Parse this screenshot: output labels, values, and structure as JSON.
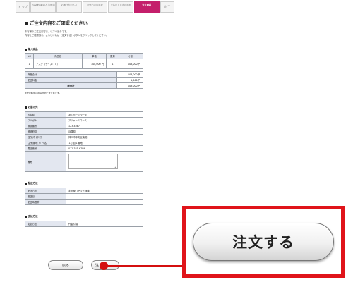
{
  "steps": [
    {
      "label": "ト ップ"
    },
    {
      "label": "お客様情報の入力/確認"
    },
    {
      "label": "お届け先の入力"
    },
    {
      "label": "配送方法の選択"
    },
    {
      "label": "支払いと方法の選択"
    },
    {
      "label": "注文確認"
    },
    {
      "label": "完 了"
    }
  ],
  "page_title": "ご注文内容をご確認ください",
  "intro": [
    "お客様のご注文内容は、以下の通りです。",
    "内容をご確認頂き、よろしければ［注文する］ボタンをクリックしてください。"
  ],
  "cart": {
    "title": "購入商品",
    "headers": [
      "NO",
      "商品名",
      "単価",
      "数量",
      "小計"
    ],
    "rows": [
      {
        "no": "1",
        "name": "アスナ（サイズ：Ｘ）",
        "price": "108,000 円",
        "qty": "1",
        "subtotal": "108,000 円"
      }
    ],
    "summary": [
      {
        "label": "商品合計",
        "value": "108,000 円"
      },
      {
        "label": "配送料金",
        "value": "1,000 円"
      },
      {
        "label": "総合計",
        "value": "109,000 円"
      }
    ],
    "note": "※配送料金は商品合計に含まれます。"
  },
  "shipping_address": {
    "title": "お届け先",
    "rows": [
      {
        "label": "お名前",
        "value": "あじゃーミラーす"
      },
      {
        "label": "フリガナ",
        "value": "アジャーミロース"
      },
      {
        "label": "郵便番号",
        "value": "123-4567"
      },
      {
        "label": "都道府県",
        "value": "兵庫県"
      },
      {
        "label": "住所(市 郡 町)",
        "value": "神戸市中央区南港"
      },
      {
        "label": "住所(番地 ｱﾊﾟｰﾄ名)",
        "value": "１丁目１番地"
      },
      {
        "label": "電話番号",
        "value": "012-345-6789"
      },
      {
        "label": "備考",
        "value": ""
      }
    ]
  },
  "delivery": {
    "title": "配送方法",
    "rows": [
      {
        "label": "配送方法",
        "value": "宅配便（ヤマト運輸）"
      },
      {
        "label": "配送日",
        "value": ""
      },
      {
        "label": "配送時間帯",
        "value": ""
      }
    ]
  },
  "payment": {
    "title": "支払方法",
    "rows": [
      {
        "label": "支払方法",
        "value": "代金引換"
      }
    ]
  },
  "buttons": {
    "back": "戻る",
    "order_small": "注",
    "order_zoom": "注文する"
  },
  "colors": {
    "accent": "#c41f6b",
    "highlight_red": "#e0141a"
  }
}
